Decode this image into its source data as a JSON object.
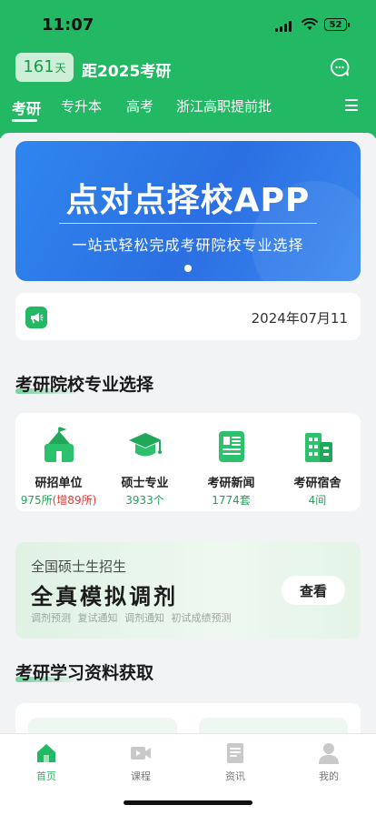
{
  "status_bar": {
    "time": "11:07",
    "battery": "52"
  },
  "header": {
    "countdown_days": "161",
    "countdown_unit": "天",
    "countdown_text": "距2025考研",
    "tabs": [
      {
        "label": "考研",
        "active": true
      },
      {
        "label": "专升本",
        "active": false
      },
      {
        "label": "高考",
        "active": false
      },
      {
        "label": "浙江高职提前批",
        "active": false
      }
    ]
  },
  "banner": {
    "title": "点对点择校APP",
    "subtitle": "一站式轻松完成考研院校专业选择"
  },
  "notice": {
    "date": "2024年07月11"
  },
  "section_school": {
    "title": "考研院校专业选择",
    "items": [
      {
        "icon": "school-building-icon",
        "label": "研招单位",
        "count": "975所",
        "extra": "(增89所)"
      },
      {
        "icon": "graduation-cap-icon",
        "label": "硕士专业",
        "count": "3933个",
        "extra": ""
      },
      {
        "icon": "newspaper-icon",
        "label": "考研新闻",
        "count": "1774套",
        "extra": ""
      },
      {
        "icon": "dormitory-icon",
        "label": "考研宿舍",
        "count": "4间",
        "extra": ""
      }
    ]
  },
  "promo": {
    "subtitle": "全国硕士生招生",
    "title": "全真模拟调剂",
    "tags": "调剂预测  复试通知  调剂通知  初试成绩预测",
    "button": "查看"
  },
  "section_study": {
    "title": "考研学习资料获取"
  },
  "tabbar": [
    {
      "label": "首页",
      "icon": "home-icon",
      "active": true
    },
    {
      "label": "课程",
      "icon": "video-icon",
      "active": false
    },
    {
      "label": "资讯",
      "icon": "document-icon",
      "active": false
    },
    {
      "label": "我的",
      "icon": "user-icon",
      "active": false
    }
  ],
  "colors": {
    "brand": "#22b864",
    "banner": "#2f86ee",
    "alert": "#e53935"
  }
}
